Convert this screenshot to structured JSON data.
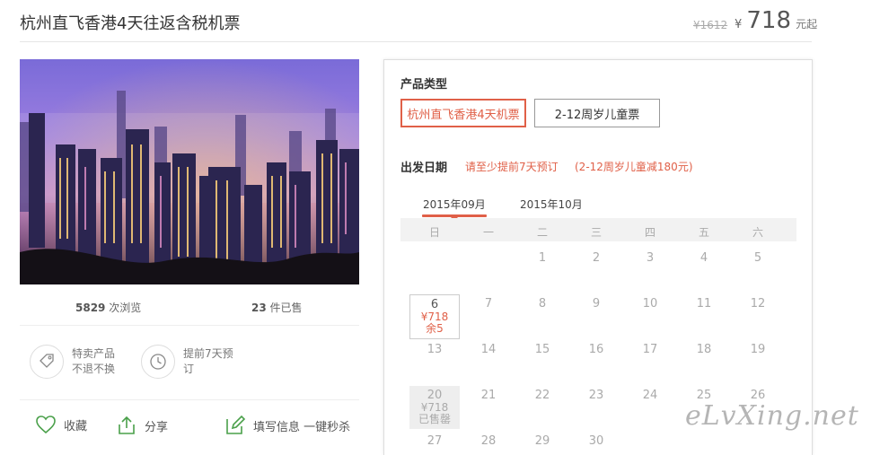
{
  "header": {
    "title": "杭州直飞香港4天往返含税机票",
    "original_price": "¥1612",
    "price_symbol": "¥",
    "price": "718",
    "price_suffix": "元起"
  },
  "stats": {
    "views_count": "5829",
    "views_label": "次浏览",
    "sold_count": "23",
    "sold_label": "件已售"
  },
  "features": [
    {
      "line1": "特卖产品",
      "line2": "不退不换",
      "icon": "tag-icon"
    },
    {
      "line1": "提前7天预",
      "line2": "订",
      "icon": "clock-icon"
    }
  ],
  "actions": {
    "favorite": "收藏",
    "share": "分享",
    "fill_info": "填写信息 一键秒杀"
  },
  "booking": {
    "product_type_label": "产品类型",
    "product_types": [
      "杭州直飞香港4天机票",
      "2-12周岁儿童票"
    ],
    "selected_product_type": "杭州直飞香港4天机票",
    "departure_label": "出发日期",
    "notice": "请至少提前7天预订",
    "child_notice": "(2-12周岁儿童减180元)",
    "months": [
      "2015年09月",
      "2015年10月"
    ],
    "active_month": "2015年09月",
    "weekdays": [
      "日",
      "一",
      "二",
      "三",
      "四",
      "五",
      "六"
    ],
    "days": {
      "d1": "1",
      "d2": "2",
      "d3": "3",
      "d4": "4",
      "d5": "5",
      "d6": "6",
      "d7": "7",
      "d8": "8",
      "d9": "9",
      "d10": "10",
      "d11": "11",
      "d12": "12",
      "d13": "13",
      "d14": "14",
      "d15": "15",
      "d16": "16",
      "d17": "17",
      "d18": "18",
      "d19": "19",
      "d20": "20",
      "d21": "21",
      "d22": "22",
      "d23": "23",
      "d24": "24",
      "d25": "25",
      "d26": "26",
      "d27": "27",
      "d28": "28",
      "d29": "29",
      "d30": "30"
    },
    "day6_price": "¥718",
    "day6_stock": "余5",
    "day20_price": "¥718",
    "day20_status": "已售罄"
  },
  "watermark": "eLvXing.net",
  "colors": {
    "accent": "#e06048",
    "muted": "#aaaaaa"
  }
}
